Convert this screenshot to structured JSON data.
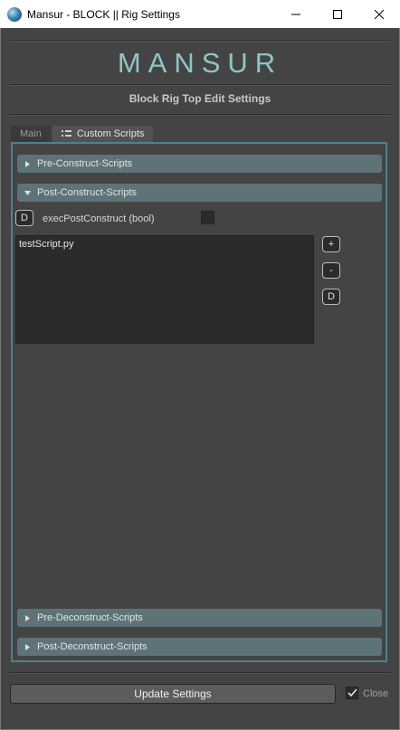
{
  "window": {
    "title": "Mansur - BLOCK  ||  Rig Settings",
    "minimize_glyph": "─",
    "maximize_glyph": "☐",
    "close_glyph": "✕"
  },
  "header": {
    "logo": "MANSUR",
    "subtitle": "Block Rig Top Edit Settings"
  },
  "tabs": [
    {
      "label": "Main",
      "active": false
    },
    {
      "label": "Custom Scripts",
      "active": true
    }
  ],
  "sections": {
    "pre_construct": {
      "label": "Pre-Construct-Scripts",
      "expanded": false
    },
    "post_construct": {
      "label": "Post-Construct-Scripts",
      "expanded": true
    },
    "pre_deconstruct": {
      "label": "Pre-Deconstruct-Scripts",
      "expanded": false
    },
    "post_deconstruct": {
      "label": "Post-Deconstruct-Scripts",
      "expanded": false
    }
  },
  "post_construct_content": {
    "default_button": "D",
    "attribute_label": "execPostConstruct (bool)",
    "attribute_checked": false,
    "scripts": [
      "testScript.py"
    ],
    "add_button": "+",
    "remove_button": "-",
    "default_list_button": "D"
  },
  "footer": {
    "update_button": "Update Settings",
    "close_label": "Close",
    "close_checked": true
  },
  "colors": {
    "accent": "#8fc5c8",
    "panel_border": "#4f7f98",
    "section_bar": "#5e7378"
  }
}
